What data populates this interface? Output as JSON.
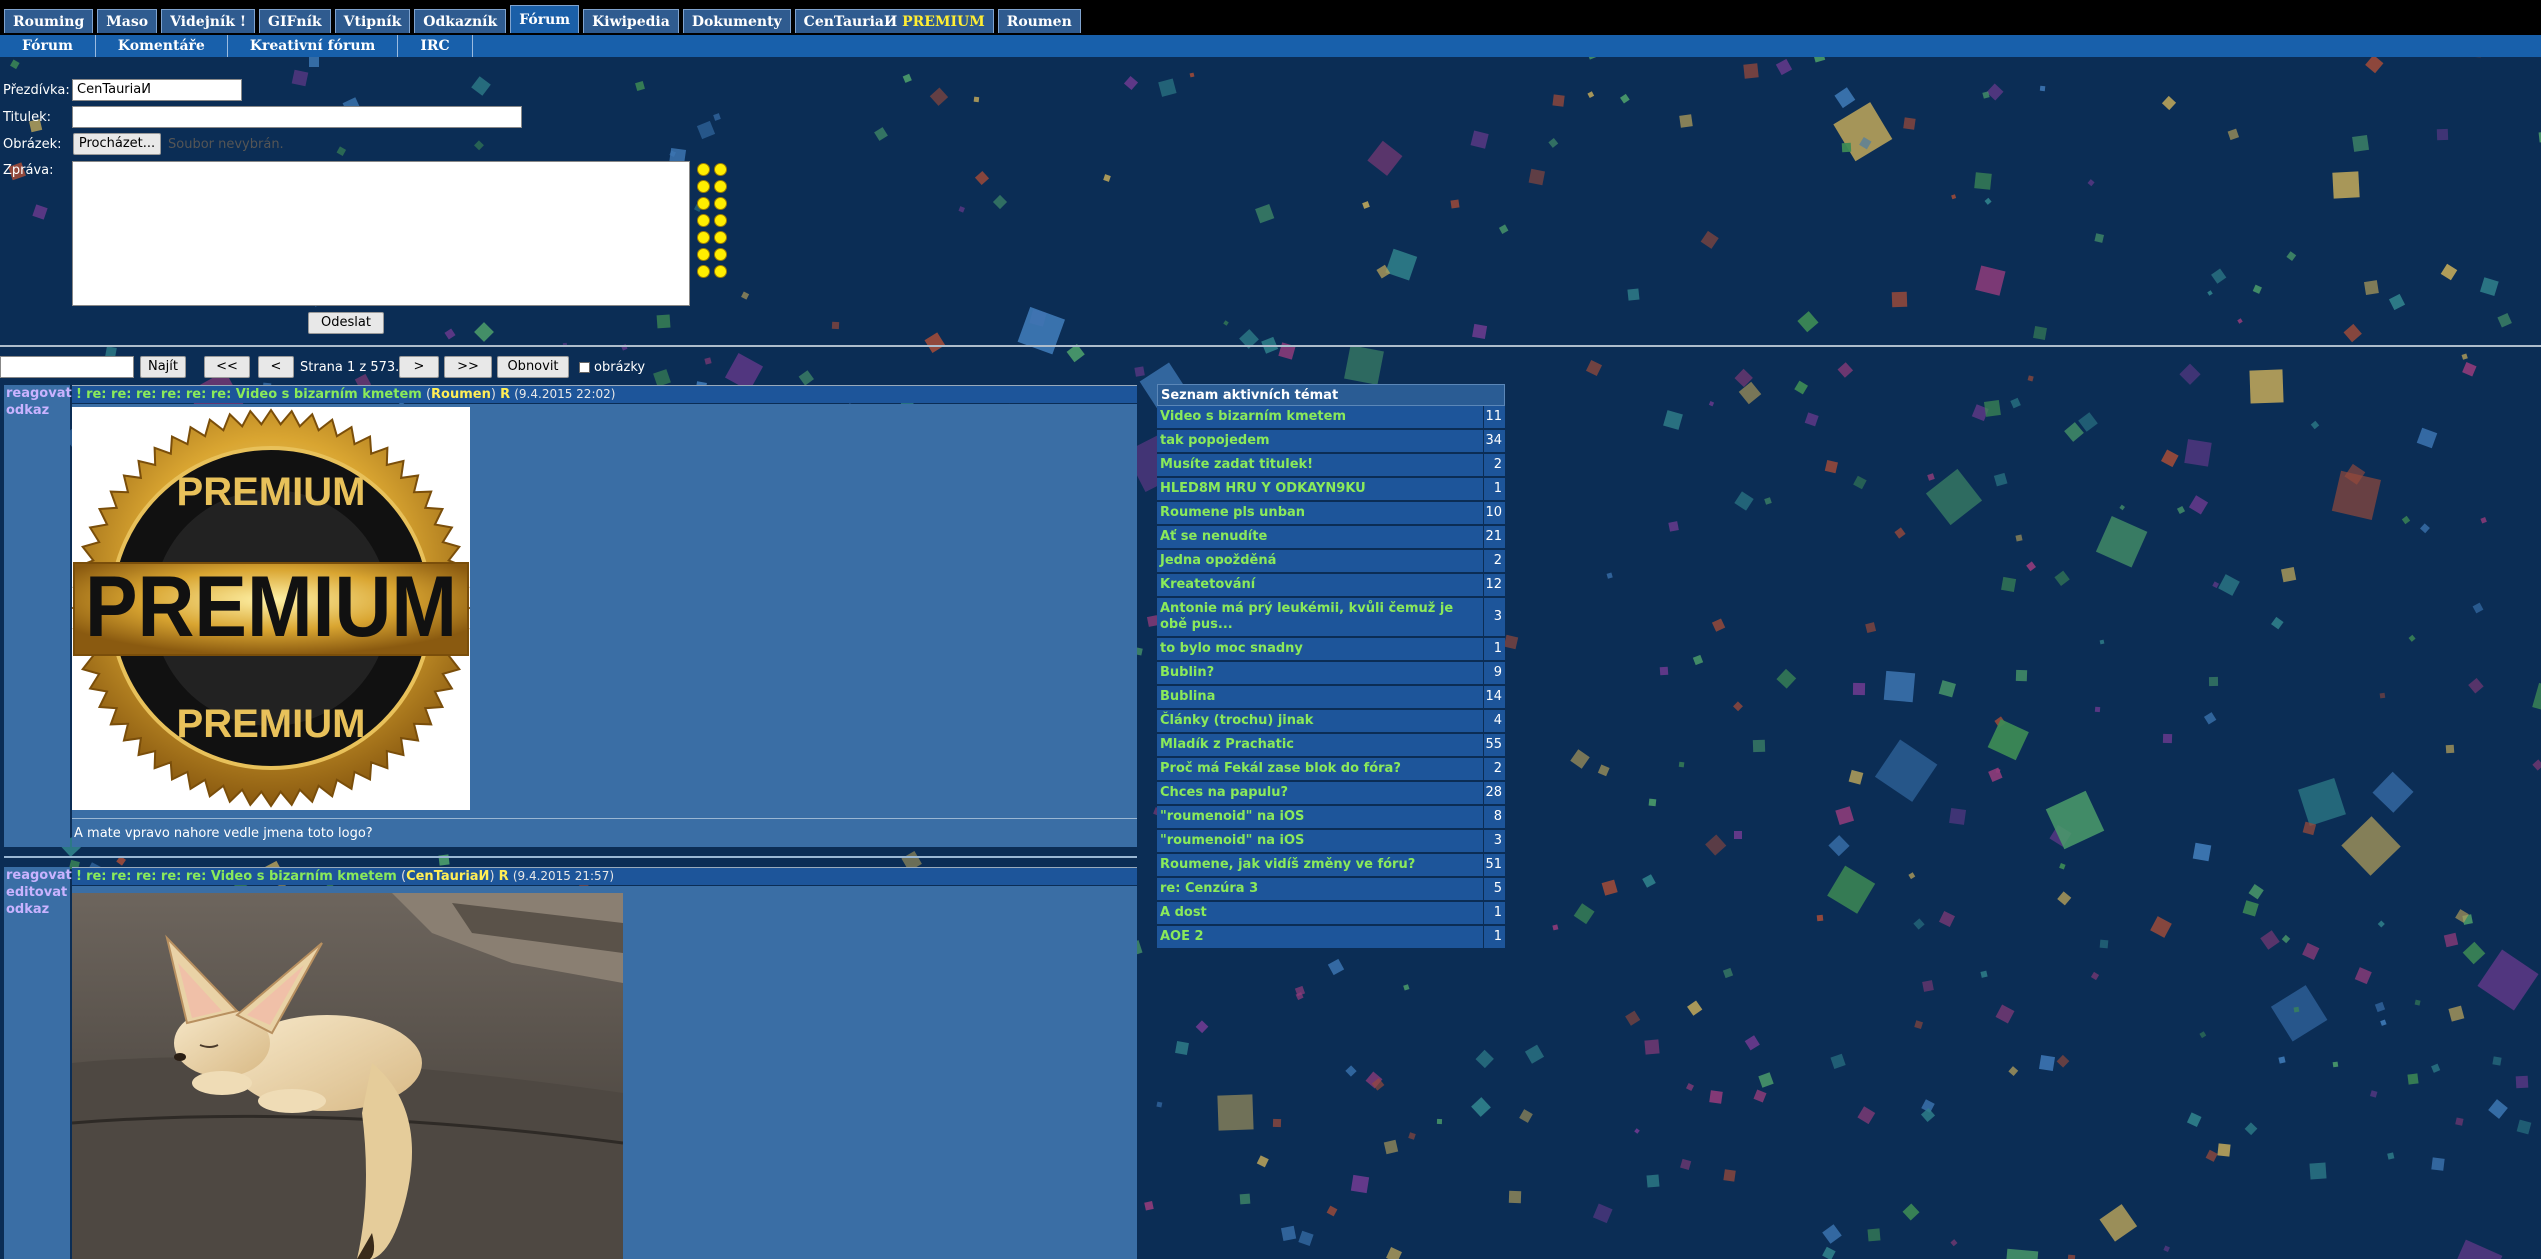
{
  "nav": {
    "tabs": [
      {
        "label": "Rouming"
      },
      {
        "label": "Maso"
      },
      {
        "label": "Videjník !"
      },
      {
        "label": "GIFník"
      },
      {
        "label": "Vtipník"
      },
      {
        "label": "Odkazník"
      },
      {
        "label": "Fórum",
        "active": true
      },
      {
        "label": "Kiwipedia"
      },
      {
        "label": "Dokumenty"
      },
      {
        "label": "CenTauriaИ",
        "badge": "PREMIUM"
      },
      {
        "label": "Roumen"
      }
    ],
    "subtabs": [
      "Fórum",
      "Komentáře",
      "Kreativní fórum",
      "IRC"
    ]
  },
  "form": {
    "nickname_label": "Přezdívka:",
    "nickname_value": "CenTauriaИ",
    "title_label": "Titulek:",
    "title_value": "",
    "image_label": "Obrázek:",
    "browse_button": "Procházet...",
    "file_status": "Soubor nevybrán.",
    "message_label": "Zpráva:",
    "submit_button": "Odeslat",
    "smiley_count": 14
  },
  "pager": {
    "search_value": "",
    "find_button": "Najít",
    "first_button": "<<",
    "prev_button": "<",
    "page_text": "Strana 1 z 573.",
    "next_button": ">",
    "last_button": ">>",
    "refresh_button": "Obnovit",
    "images_checkbox_label": "obrázky",
    "images_checked": false
  },
  "posts": [
    {
      "actions": [
        "reagovat",
        "odkaz"
      ],
      "marker": "!",
      "title": "re: re: re: re: re: re: Video s bizarním kmetem",
      "author": "Roumen",
      "flag": "R",
      "date": "(9.4.2015 22:02)",
      "image_alt": "PREMIUM",
      "text": "A mate vpravo nahore vedle jmena toto logo?"
    },
    {
      "actions": [
        "reagovat",
        "editovat",
        "odkaz"
      ],
      "marker": "!",
      "title": "re: re: re: re: re: Video s bizarním kmetem",
      "author": "CenTauriaИ",
      "flag": "R",
      "date": "(9.4.2015 21:57)",
      "image_alt": "fennec-fox-photo"
    }
  ],
  "topics": {
    "header": "Seznam aktivních témat",
    "items": [
      {
        "name": "Video s bizarním kmetem",
        "count": "11"
      },
      {
        "name": "tak popojedem",
        "count": "34"
      },
      {
        "name": "Musíte zadat titulek!",
        "count": "2"
      },
      {
        "name": "HLED8M HRU Y ODKAYN9KU",
        "count": "1"
      },
      {
        "name": "Roumene pls unban",
        "count": "10"
      },
      {
        "name": "Ať se nenudíte",
        "count": "21"
      },
      {
        "name": "Jedna opožděná",
        "count": "2"
      },
      {
        "name": "Kreatetování",
        "count": "12"
      },
      {
        "name": "Antonie má prý leukémii, kvůli čemuž je obě pus...",
        "count": "3"
      },
      {
        "name": "to bylo moc snadny",
        "count": "1"
      },
      {
        "name": "Bublin?",
        "count": "9"
      },
      {
        "name": "Bublina",
        "count": "14"
      },
      {
        "name": "Články (trochu) jinak",
        "count": "4"
      },
      {
        "name": "Mladík z Prachatic",
        "count": "55"
      },
      {
        "name": "Proč má Fekál zase blok do fóra?",
        "count": "2"
      },
      {
        "name": "Chces na papulu?",
        "count": "28"
      },
      {
        "name": "\"roumenoid\" na iOS",
        "count": "8"
      },
      {
        "name": "\"roumenoid\" na iOS",
        "count": "3"
      },
      {
        "name": "Roumene, jak vidíš změny ve fóru?",
        "count": "51"
      },
      {
        "name": "re: Cenzúra 3",
        "count": "5"
      },
      {
        "name": "A dost",
        "count": "1"
      },
      {
        "name": "AOE 2",
        "count": "1"
      }
    ]
  },
  "colors": {
    "background": "#0b2d55",
    "post_title": "#8aea5a",
    "author": "#ffee55",
    "action_link": "#c9b3ff",
    "premium_badge": "#ffee33"
  }
}
